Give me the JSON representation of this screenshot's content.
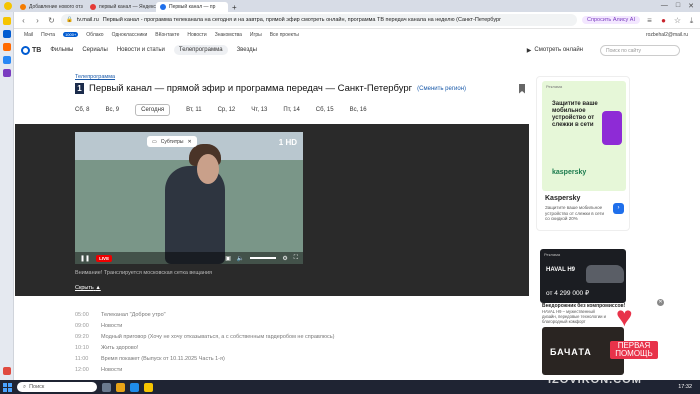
{
  "browser": {
    "tabs": [
      {
        "label": "Добавление нового отз",
        "icon_color": "#f57c00",
        "active": false
      },
      {
        "label": "первый канал — Яндекс",
        "icon_color": "#e53935",
        "active": false
      },
      {
        "label": "Первый канал — пр",
        "icon_color": "#1f6feb",
        "active": true
      },
      {
        "label": "+",
        "icon_color": "",
        "active": false
      }
    ],
    "url_domain": "tv.mail.ru",
    "page_title": "Первый канал - программа телеканала на сегодня и на завтра, прямой эфир смотреть онлайн, программа ТВ передач канала на неделю (Санкт-Петербург",
    "alisa_label": "Спросить Алису AI"
  },
  "services": [
    "Mail",
    "Почта",
    "Облако",
    "Одноклассники",
    "ВКонтакте",
    "Новости",
    "Знакомства",
    "Игры",
    "Все проекты"
  ],
  "services_badge": "1000+",
  "user_email": "rozbehal2@mail.ru",
  "site": {
    "logo_text": "ТВ",
    "nav": [
      "Фильмы",
      "Сериалы",
      "Новости и статьи",
      "Телепрограмма",
      "Звезды"
    ],
    "nav_selected": "Телепрограмма",
    "watch_online": "Смотреть онлайн",
    "search_placeholder": "Поиск по сайту"
  },
  "page": {
    "breadcrumb": "Телепрограмма",
    "channel_badge": "1",
    "title": "Первый канал — прямой эфир и программа передач — Санкт-Петербург",
    "change_region": "(Сменить регион)",
    "days": [
      "Сб, 8",
      "Вс, 9",
      "Сегодня",
      "Вт, 11",
      "Ср, 12",
      "Чт, 13",
      "Пт, 14",
      "Сб, 15",
      "Вс, 16"
    ],
    "selected_day": "Сегодня"
  },
  "player": {
    "subtitles": "Субтитры",
    "live": "LIVE",
    "channel_logo": "1 HD",
    "notice": "Внимание! Транслируется московская сетка вещания",
    "hide": "Скрыть"
  },
  "schedule": [
    {
      "time": "05:00",
      "title": "Телеканал \"Доброе утро\""
    },
    {
      "time": "09:00",
      "title": "Новости"
    },
    {
      "time": "09:20",
      "title": "Модный приговор (Хочу не хочу отказываться, а с собственным гардеробом не справлюсь)"
    },
    {
      "time": "10:10",
      "title": "Жить здорово!"
    },
    {
      "time": "11:00",
      "title": "Время покажет (Выпуск от 10.11.2025 Часть 1-я)"
    },
    {
      "time": "12:00",
      "title": "Новости"
    }
  ],
  "ads": {
    "ad1_label": "Реклама",
    "ad1_headline": "Защитите ваше мобильное устройство от слежки в сети",
    "ad1_brand_logo": "kaspersky",
    "ad1_title": "Kaspersky",
    "ad1_desc": "Защитите ваше мобильное устройство от слежки в сети со скидкой 20%",
    "ad2_label": "Реклама",
    "ad2_brand": "HAVAL H9",
    "ad2_price": "от 4 299 000 ₽",
    "ad2_title": "Внедорожник без компромиссов!",
    "ad2_desc": "HAVAL H9 – мужественный дизайн, передовые технологии и благородный комфорт",
    "ad3_text": "БАЧАТА"
  },
  "promo": "ПЕРВАЯ ПОМОЩЬ",
  "taskbar": {
    "search": "Поиск",
    "clock": "17:32"
  },
  "watermark": "IZOVIKON.COM",
  "colors": {
    "accent": "#005bd1",
    "live_red": "#e00000",
    "band": "#2a2a2a"
  }
}
